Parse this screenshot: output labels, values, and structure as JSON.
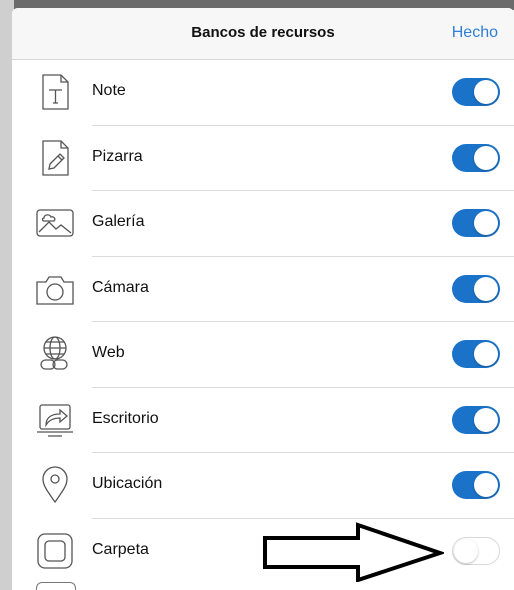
{
  "navbar": {
    "title": "Bancos de recursos",
    "done_label": "Hecho"
  },
  "items": [
    {
      "label": "Note",
      "icon": "text-note-icon",
      "enabled": true
    },
    {
      "label": "Pizarra",
      "icon": "whiteboard-pencil-icon",
      "enabled": true
    },
    {
      "label": "Galería",
      "icon": "gallery-photo-icon",
      "enabled": true
    },
    {
      "label": "Cámara",
      "icon": "camera-icon",
      "enabled": true
    },
    {
      "label": "Web",
      "icon": "globe-link-icon",
      "enabled": true
    },
    {
      "label": "Escritorio",
      "icon": "desktop-share-icon",
      "enabled": true
    },
    {
      "label": "Ubicación",
      "icon": "location-pin-icon",
      "enabled": true
    },
    {
      "label": "Carpeta",
      "icon": "folder-icon",
      "enabled": false
    }
  ],
  "colors": {
    "accent": "#1a73c9",
    "done_link": "#2f7fd6"
  }
}
